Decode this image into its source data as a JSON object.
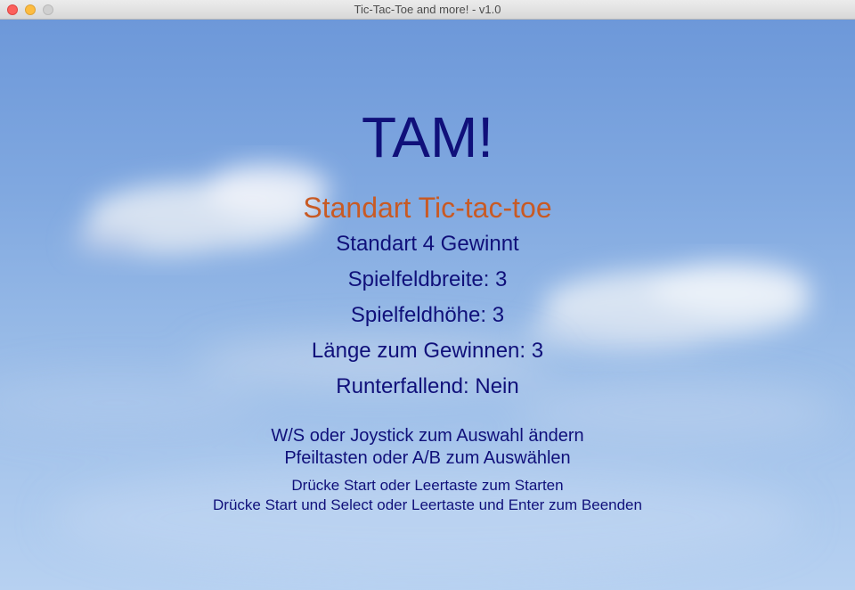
{
  "window": {
    "title": "Tic-Tac-Toe and more! - v1.0"
  },
  "game": {
    "title": "TAM!",
    "selected_mode": "Standart Tic-tac-toe",
    "menu_items": [
      "Standart 4 Gewinnt",
      "Spielfeldbreite: 3",
      "Spielfeldhöhe: 3",
      "Länge zum Gewinnen: 3",
      "Runterfallend: Nein"
    ],
    "instructions": [
      "W/S oder Joystick zum Auswahl ändern",
      "Pfeiltasten oder A/B zum Auswählen",
      "Drücke Start oder Leertaste zum Starten",
      "Drücke Start und Select oder Leertaste und Enter zum Beenden"
    ]
  },
  "colors": {
    "title": "#10107a",
    "selected": "#c85a24",
    "text": "#10107a"
  }
}
